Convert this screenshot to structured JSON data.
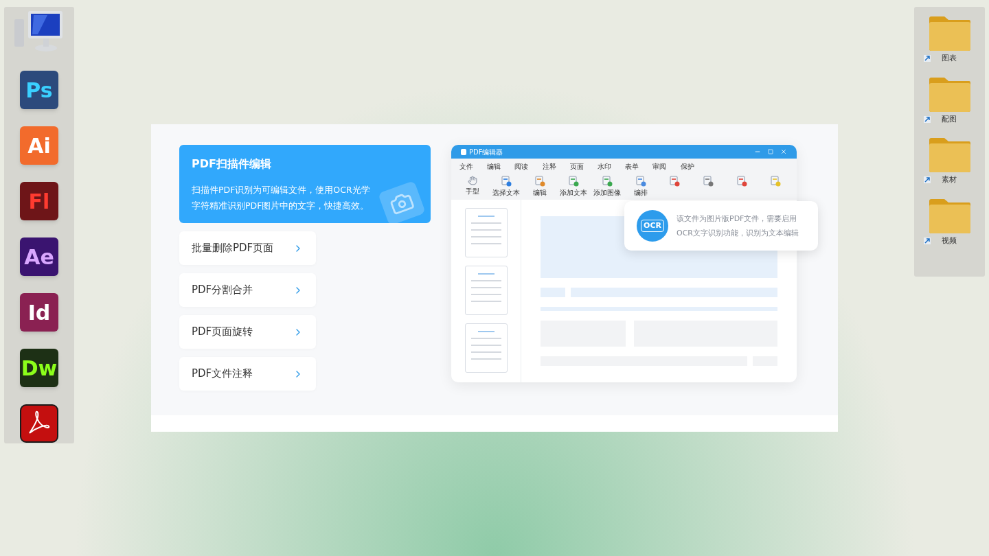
{
  "dock": [
    {
      "kind": "computer"
    },
    {
      "kind": "app",
      "label": "Ps",
      "color": "#2c4a7c"
    },
    {
      "kind": "app",
      "label": "Ai",
      "color": "#f26b2c"
    },
    {
      "kind": "app",
      "label": "Fl",
      "color": "#6e1518"
    },
    {
      "kind": "app",
      "label": "Ae",
      "color": "#3a1470"
    },
    {
      "kind": "app",
      "label": "Id",
      "color": "#8a2152"
    },
    {
      "kind": "app",
      "label": "Dw",
      "color": "#1d3015"
    },
    {
      "kind": "pdf"
    }
  ],
  "features": [
    {
      "title": "PDF扫描件编辑",
      "description": "扫描件PDF识别为可编辑文件，使用OCR光学字符精准识别PDF图片中的文字，快捷高效。",
      "selected": true
    },
    {
      "title": "批量删除PDF页面",
      "selected": false
    },
    {
      "title": "PDF分割合并",
      "selected": false
    },
    {
      "title": "PDF页面旋转",
      "selected": false
    },
    {
      "title": "PDF文件注释",
      "selected": false
    }
  ],
  "editor": {
    "title": "PDF编辑器",
    "menu": [
      "文件",
      "编辑",
      "阅读",
      "注释",
      "页面",
      "水印",
      "表单",
      "审阅",
      "保护"
    ],
    "toolbar": [
      {
        "kind": "labelled",
        "label": "手型"
      },
      {
        "kind": "labelled",
        "label": "选择文本"
      },
      {
        "kind": "labelled",
        "label": "编辑"
      },
      {
        "kind": "labelled",
        "label": "添加文本"
      },
      {
        "kind": "labelled",
        "label": "添加图像"
      },
      {
        "kind": "labelled",
        "label": "编排"
      },
      {
        "kind": "icon"
      },
      {
        "kind": "icon"
      },
      {
        "kind": "icon"
      },
      {
        "kind": "icon"
      }
    ],
    "ocr_tip": {
      "badge": "OCR",
      "text": "该文件为图片版PDF文件，需要启用OCR文字识别功能，识别为文本编辑"
    }
  },
  "folders": [
    {
      "label": "图表"
    },
    {
      "label": "配图"
    },
    {
      "label": "素材"
    },
    {
      "label": "视频"
    }
  ]
}
